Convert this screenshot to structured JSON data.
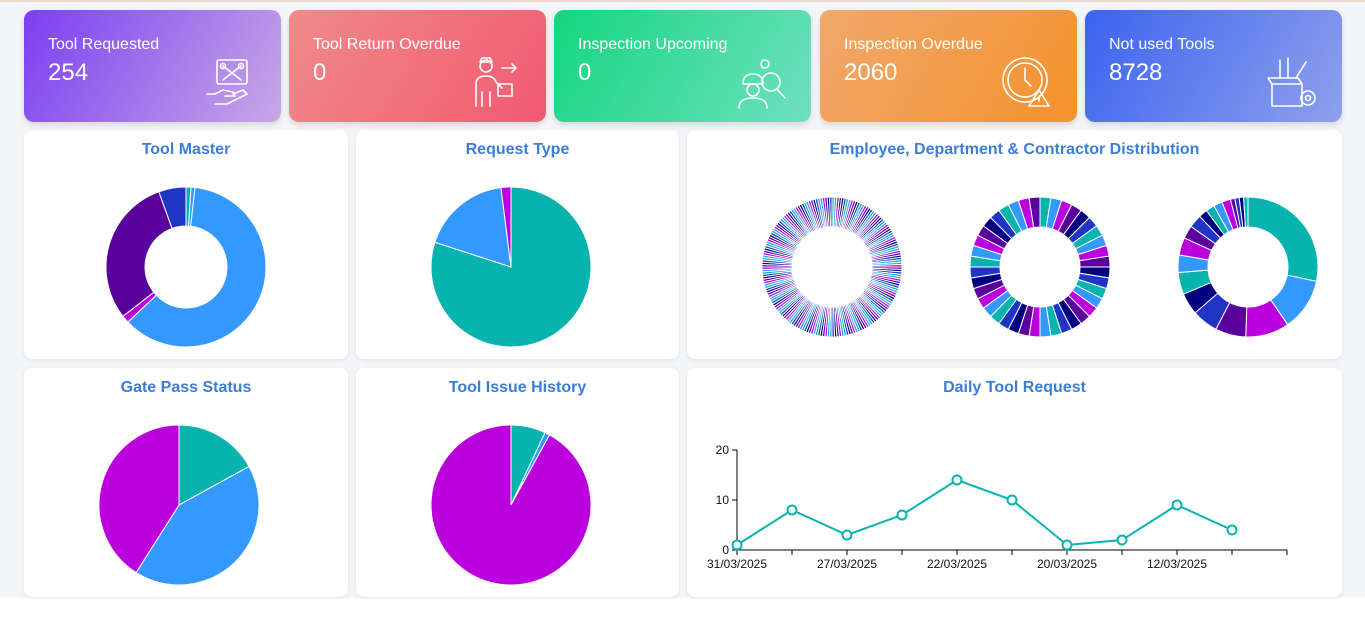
{
  "stats": [
    {
      "title": "Tool Requested",
      "value": "254",
      "icon": "tool-request-icon",
      "gradient": [
        "#7b3ff2",
        "#c8a8e6"
      ]
    },
    {
      "title": "Tool Return Overdue",
      "value": "0",
      "icon": "delivery-person-icon",
      "gradient": [
        "#f08a8a",
        "#f25a72"
      ]
    },
    {
      "title": "Inspection Upcoming",
      "value": "0",
      "icon": "inspector-icon",
      "gradient": [
        "#14d67f",
        "#6fe0c0"
      ]
    },
    {
      "title": "Inspection Overdue",
      "value": "2060",
      "icon": "clock-warning-icon",
      "gradient": [
        "#f0a86c",
        "#f5922c"
      ]
    },
    {
      "title": "Not used Tools",
      "value": "8728",
      "icon": "toolbox-icon",
      "gradient": [
        "#3b63f0",
        "#8fa0ec"
      ]
    }
  ],
  "panels": {
    "tool_master": "Tool Master",
    "request_type": "Request Type",
    "distribution": "Employee, Department & Contractor Distribution",
    "gate_pass": "Gate Pass Status",
    "issue_history": "Tool Issue History",
    "daily_request": "Daily Tool Request"
  },
  "colors": {
    "teal": "#06b3ae",
    "blue": "#3399ff",
    "purple": "#bb00dd",
    "indigo": "#5a009c",
    "navy": "#2035c4",
    "title": "#3b7dd8"
  },
  "chart_data": [
    {
      "type": "pie",
      "variant": "donut",
      "title": "Tool Master",
      "values": [
        1,
        0.8,
        61,
        1.5,
        30,
        5.5
      ],
      "colors": [
        "#06b3ae",
        "#3399ff",
        "#3399ff",
        "#bb00dd",
        "#5a009c",
        "#2035c4"
      ]
    },
    {
      "type": "pie",
      "title": "Request Type",
      "values": [
        80,
        18,
        2
      ],
      "colors": [
        "#06b3ae",
        "#3399ff",
        "#bb00dd"
      ]
    },
    {
      "type": "pie",
      "variant": "donut",
      "title": "Employee, Department & Contractor Distribution",
      "series": [
        {
          "segments": 180,
          "palette": [
            "#06b3ae",
            "#3399ff",
            "#bb00dd",
            "#5a009c",
            "#000080",
            "#2035c4"
          ]
        },
        {
          "segments": 40,
          "palette": [
            "#06b3ae",
            "#3399ff",
            "#bb00dd",
            "#5a009c",
            "#000080",
            "#2035c4"
          ]
        },
        {
          "values": [
            28,
            12,
            10,
            7,
            6,
            5,
            5,
            4,
            4,
            3,
            3,
            2,
            2,
            2,
            2,
            1,
            1,
            1,
            1
          ],
          "palette": [
            "#06b3ae",
            "#3399ff",
            "#bb00dd",
            "#5a009c",
            "#2035c4",
            "#000080"
          ]
        }
      ]
    },
    {
      "type": "pie",
      "title": "Gate Pass Status",
      "values": [
        17,
        42,
        41
      ],
      "colors": [
        "#06b3ae",
        "#3399ff",
        "#bb00dd"
      ]
    },
    {
      "type": "pie",
      "title": "Tool Issue History",
      "values": [
        7,
        1,
        92
      ],
      "colors": [
        "#06b3ae",
        "#3399ff",
        "#bb00dd"
      ]
    },
    {
      "type": "line",
      "title": "Daily Tool Request",
      "x": [
        "31/03/2025",
        "",
        "27/03/2025",
        "",
        "22/03/2025",
        "",
        "20/03/2025",
        "",
        "12/03/2025",
        ""
      ],
      "tick_labels": [
        "31/03/2025",
        "27/03/2025",
        "22/03/2025",
        "20/03/2025",
        "12/03/2025"
      ],
      "y": [
        1,
        8,
        3,
        7,
        14,
        10,
        1,
        2,
        9,
        4
      ],
      "ylim": [
        0,
        20
      ],
      "yticks": [
        0,
        10,
        20
      ],
      "color": "#06b3ae"
    }
  ]
}
